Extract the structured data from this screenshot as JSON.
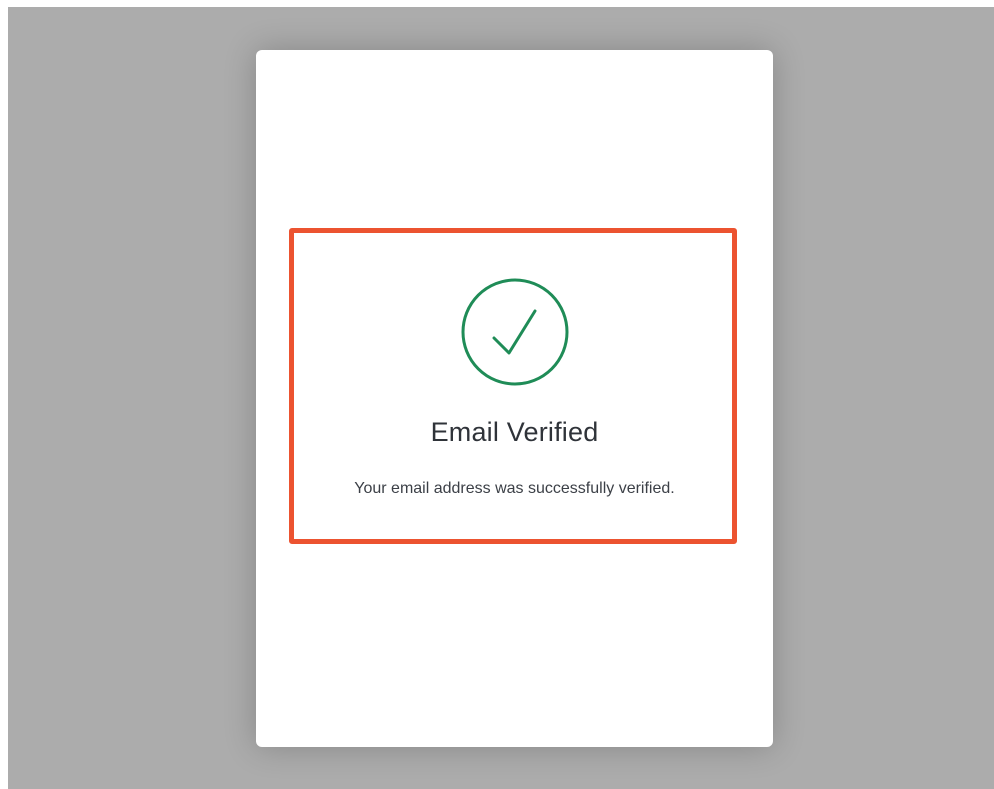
{
  "colors": {
    "backdrop": "#acacac",
    "card": "#ffffff",
    "success_green": "#1f8c57",
    "highlight_border": "#ec5330",
    "title_text": "#2f3339",
    "body_text": "#3c4047"
  },
  "status": {
    "icon": "check-circle-icon",
    "title": "Email Verified",
    "message": "Your email address was successfully verified."
  }
}
